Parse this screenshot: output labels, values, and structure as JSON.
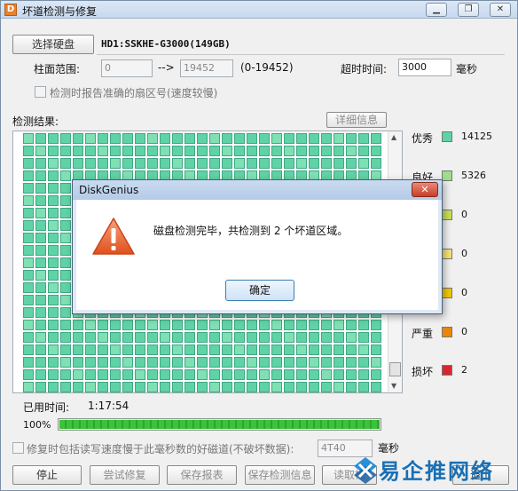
{
  "window": {
    "title": "坏道检测与修复",
    "app_icon_letter": "D"
  },
  "top": {
    "select_disk_button": "选择硬盘",
    "disk_name": "HD1:SSKHE-G3000(149GB)",
    "cylinder_range_label": "柱面范围:",
    "cylinder_from": "0",
    "range_arrow": "-->",
    "cylinder_to": "19452",
    "cylinder_hint": "(0-19452)",
    "timeout_label": "超时时间:",
    "timeout_value": "3000",
    "timeout_unit": "毫秒",
    "report_sector_option": "检测时报告准确的扇区号(速度较慢)"
  },
  "results": {
    "label": "检测结果:",
    "details_button": "详细信息"
  },
  "legend": [
    {
      "name": "优秀",
      "count": "14125",
      "color": "#5fd3a6"
    },
    {
      "name": "良好",
      "count": "5326",
      "color": "#9be08c"
    },
    {
      "name": "",
      "count": "0",
      "color": "#c8e05a"
    },
    {
      "name": "",
      "count": "0",
      "color": "#f2e27a"
    },
    {
      "name": "",
      "count": "0",
      "color": "#f2c800"
    },
    {
      "name": "严重",
      "count": "0",
      "color": "#e8860a"
    },
    {
      "name": "损坏",
      "count": "2",
      "color": "#d8262f"
    }
  ],
  "elapsed": {
    "label": "已用时间:",
    "value": "1:17:54"
  },
  "progress": {
    "text": "100%",
    "fraction": 1.0
  },
  "repair": {
    "option": "修复时包括读写速度慢于此毫秒数的好磁道(不破坏数据):",
    "value": "4T40",
    "unit": "毫秒"
  },
  "bottom_buttons": {
    "stop": "停止",
    "try_repair": "尝试修复",
    "save_report": "保存报表",
    "save_check_info": "保存检测信息",
    "read": "读取检",
    "exit": "退出"
  },
  "dialog": {
    "title": "DiskGenius",
    "close_glyph": "✕",
    "message": "磁盘检测完毕，共检测到 2 个坏道区域。",
    "ok_button": "确定"
  },
  "watermark": {
    "text": "易企推网络"
  },
  "icons": {
    "minimize": "minimize-icon",
    "restore": "restore-icon",
    "close": "close-icon",
    "warning": "warning-icon",
    "logo": "watermark-logo-icon"
  }
}
